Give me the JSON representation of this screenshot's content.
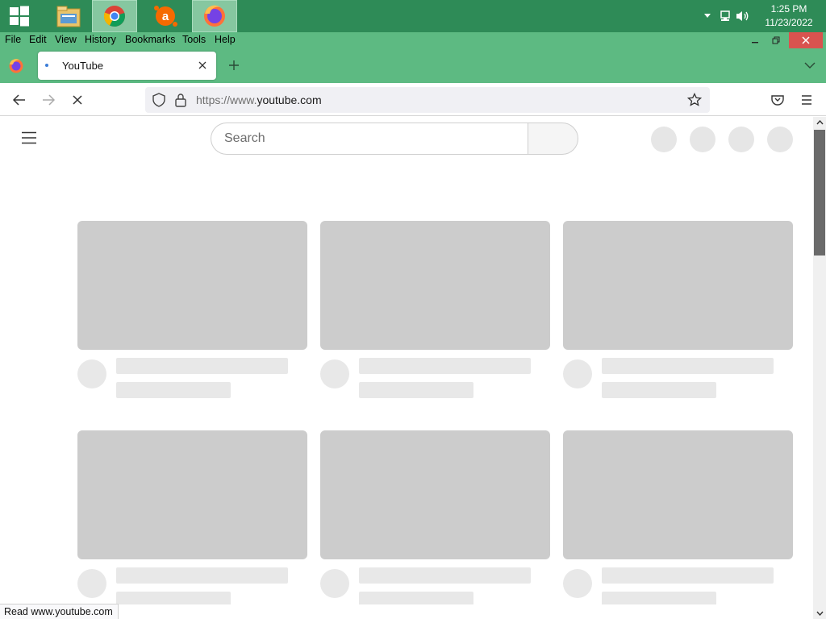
{
  "taskbar": {
    "apps": [
      "file-explorer-icon",
      "chrome-icon",
      "avast-icon",
      "firefox-icon"
    ],
    "clock": {
      "time": "1:25 PM",
      "date": "11/23/2022"
    }
  },
  "menubar": {
    "items": [
      {
        "label": "File"
      },
      {
        "label": "Edit"
      },
      {
        "label": "View"
      },
      {
        "label": "History"
      },
      {
        "label": "Bookmarks"
      },
      {
        "label": "Tools"
      },
      {
        "label": "Help"
      }
    ]
  },
  "tab": {
    "title": "YouTube"
  },
  "urlbar": {
    "scheme": "https://www.",
    "host": "youtube.com"
  },
  "page": {
    "search_placeholder": "Search"
  },
  "status": {
    "text": "Read www.youtube.com"
  },
  "colors": {
    "taskbar": "#2e8b57",
    "toolbar": "#5dba82",
    "skeleton": "#cccccc",
    "skeleton_light": "#e8e8e8"
  }
}
